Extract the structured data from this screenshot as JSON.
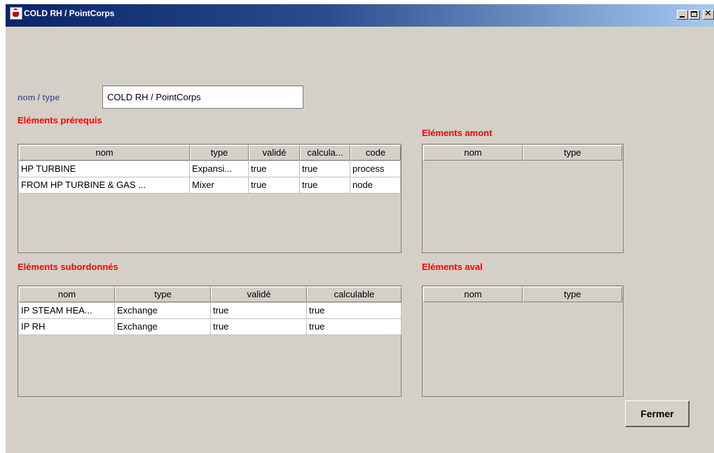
{
  "window": {
    "title": "COLD RH / PointCorps",
    "controls": [
      "minimize",
      "maximize",
      "close"
    ]
  },
  "field": {
    "label": "nom / type",
    "value": "COLD RH / PointCorps"
  },
  "prerequis": {
    "title": "Eléments prérequis",
    "headers": [
      "nom",
      "type",
      "validé",
      "calcula...",
      "code"
    ],
    "rows": [
      [
        "HP TURBINE",
        "Expansi...",
        "true",
        "true",
        "process"
      ],
      [
        "FROM HP TURBINE & GAS ...",
        "Mixer",
        "true",
        "true",
        "node"
      ]
    ]
  },
  "subordonnes": {
    "title": "Eléments subordonnés",
    "headers": [
      "nom",
      "type",
      "validé",
      "calculable"
    ],
    "rows": [
      [
        "IP STEAM HEA...",
        "Exchange",
        "true",
        "true"
      ],
      [
        "IP RH",
        "Exchange",
        "true",
        "true"
      ]
    ]
  },
  "amont": {
    "title": "Eléments amont",
    "headers": [
      "nom",
      "type"
    ],
    "rows": []
  },
  "aval": {
    "title": "Eléments aval",
    "headers": [
      "nom",
      "type"
    ],
    "rows": []
  },
  "close_button": "Fermer"
}
